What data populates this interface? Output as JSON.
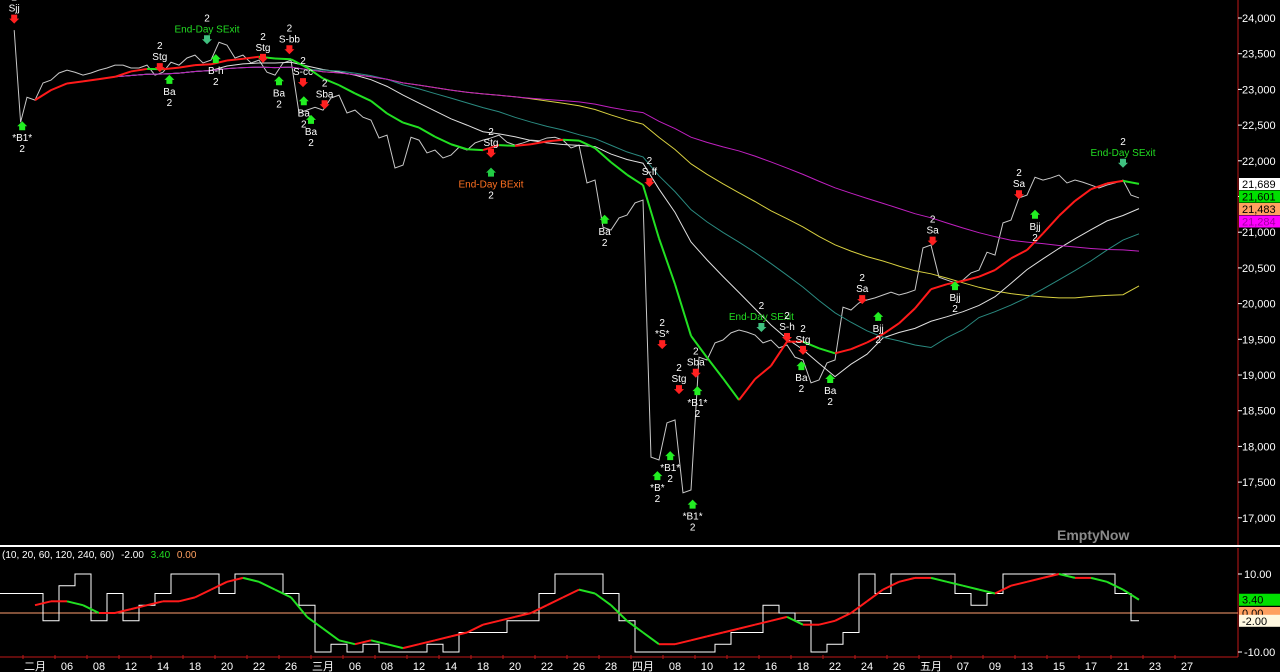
{
  "chart_data": {
    "type": "line",
    "title": "",
    "price_axis": {
      "ylim": [
        16600,
        24250
      ],
      "ticks": [
        "24,000",
        "23,500",
        "23,000",
        "22,500",
        "22,000",
        "21,500",
        "21,000",
        "20,500",
        "20,000",
        "19,500",
        "19,000",
        "18,500",
        "18,000",
        "17,500",
        "17,000"
      ],
      "tick_values": [
        24000,
        23500,
        23000,
        22500,
        22000,
        21500,
        21000,
        20500,
        20000,
        19500,
        19000,
        18500,
        18000,
        17500,
        17000
      ]
    },
    "x_axis_labels": [
      "二月",
      "06",
      "08",
      "12",
      "14",
      "18",
      "20",
      "22",
      "26",
      "三月",
      "06",
      "08",
      "12",
      "14",
      "18",
      "20",
      "22",
      "26",
      "28",
      "四月",
      "08",
      "10",
      "12",
      "16",
      "18",
      "22",
      "24",
      "26",
      "五月",
      "07",
      "09",
      "13",
      "15",
      "17",
      "21",
      "23",
      "27"
    ],
    "price": {
      "name": "Close",
      "color": "#c8c8c8",
      "start": [
        23830,
        22540
      ],
      "values": [
        22850,
        23130,
        23270,
        23200,
        23270,
        23340,
        23300,
        23340,
        23240,
        23340,
        23480,
        23410,
        23620,
        23480,
        23410,
        23200,
        23410,
        22710,
        22710,
        22920,
        22710,
        22570,
        22360,
        21940,
        22290,
        22150,
        22080,
        22150,
        22290,
        22360,
        22220,
        22290,
        22320,
        22290,
        22220,
        21730,
        21030,
        21240,
        21450,
        17810,
        18370,
        17390,
        19210,
        19490,
        19630,
        19560,
        19490,
        19420,
        19210,
        18930,
        19210,
        19910,
        20050,
        20120,
        20120,
        20190,
        20820,
        20330,
        20330,
        20470,
        20680,
        21170,
        21520,
        21730,
        21800,
        21730,
        21660,
        21660,
        21730,
        21480
      ]
    },
    "moving_averages": [
      {
        "name": "MA-yellow",
        "period": 30,
        "color": "#d8d040"
      },
      {
        "name": "MA-white",
        "period": 12,
        "color": "#e0e0e0"
      },
      {
        "name": "MA-teal",
        "period": 18,
        "color": "#2a8a80"
      },
      {
        "name": "MA-magenta",
        "period": 45,
        "color": "#c020c0"
      },
      {
        "name": "MA-trend",
        "period": 6,
        "color_up": "#ff1a1a",
        "color_down": "#22e022"
      }
    ],
    "annotations": [
      {
        "day": -1.3,
        "price": 23950,
        "label": "Sjj",
        "count": "2",
        "type": "sell"
      },
      {
        "day": -0.8,
        "price": 22540,
        "label": "*B1*",
        "count": "2",
        "type": "buy"
      },
      {
        "day": 7.8,
        "price": 23270,
        "label": "Stg",
        "count": "2",
        "type": "sell"
      },
      {
        "day": 8.4,
        "price": 23190,
        "label": "Ba",
        "count": "2",
        "type": "buy"
      },
      {
        "day": 10.75,
        "price": 23660,
        "label": "End-Day SExit",
        "count": "2",
        "type": "exit-sell"
      },
      {
        "day": 11.3,
        "price": 23480,
        "label": "B-h",
        "count": "2",
        "type": "buy"
      },
      {
        "day": 14.25,
        "price": 23400,
        "label": "Stg",
        "count": "2",
        "type": "sell"
      },
      {
        "day": 15.25,
        "price": 23170,
        "label": "Ba",
        "count": "2",
        "type": "buy"
      },
      {
        "day": 15.9,
        "price": 23520,
        "label": "S-bb",
        "count": "2",
        "type": "sell"
      },
      {
        "day": 16.75,
        "price": 23060,
        "label": "S-cc",
        "count": "2",
        "type": "sell"
      },
      {
        "day": 16.8,
        "price": 22890,
        "label": "Ba",
        "count": "2",
        "type": "buy"
      },
      {
        "day": 18.1,
        "price": 22750,
        "label": "Sba",
        "count": "2",
        "type": "sell"
      },
      {
        "day": 17.25,
        "price": 22630,
        "label": "Ba",
        "count": "2",
        "type": "buy"
      },
      {
        "day": 28.5,
        "price": 22070,
        "label": "Stg",
        "count": "2",
        "type": "sell"
      },
      {
        "day": 28.5,
        "price": 21890,
        "label": "End-Day BExit",
        "count": "2",
        "type": "exit-buy"
      },
      {
        "day": 35.6,
        "price": 21230,
        "label": "Ba",
        "count": "2",
        "type": "buy"
      },
      {
        "day": 38.4,
        "price": 21660,
        "label": "S-ff",
        "count": "2",
        "type": "sell"
      },
      {
        "day": 39.2,
        "price": 19390,
        "label": "*S*",
        "count": "2",
        "type": "sell"
      },
      {
        "day": 38.9,
        "price": 17640,
        "label": "*B*",
        "count": "2",
        "type": "buy"
      },
      {
        "day": 39.7,
        "price": 17920,
        "label": "*B1*",
        "count": "2",
        "type": "buy"
      },
      {
        "day": 40.25,
        "price": 18760,
        "label": "Stg",
        "count": "2",
        "type": "sell"
      },
      {
        "day": 41.3,
        "price": 18990,
        "label": "Sba",
        "count": "2",
        "type": "sell"
      },
      {
        "day": 41.4,
        "price": 18830,
        "label": "*B1*",
        "count": "2",
        "type": "buy"
      },
      {
        "day": 41.1,
        "price": 17240,
        "label": "*B1*",
        "count": "2",
        "type": "buy"
      },
      {
        "day": 45.4,
        "price": 19630,
        "label": "End-Day SExit",
        "count": "2",
        "type": "exit-sell"
      },
      {
        "day": 47,
        "price": 19490,
        "label": "S-h",
        "count": "2",
        "type": "sell"
      },
      {
        "day": 48,
        "price": 19310,
        "label": "Stg",
        "count": "2",
        "type": "sell"
      },
      {
        "day": 47.9,
        "price": 19180,
        "label": "Ba",
        "count": "2",
        "type": "buy"
      },
      {
        "day": 49.7,
        "price": 19000,
        "label": "Ba",
        "count": "2",
        "type": "buy"
      },
      {
        "day": 51.7,
        "price": 20020,
        "label": "Sa",
        "count": "2",
        "type": "sell"
      },
      {
        "day": 52.7,
        "price": 19870,
        "label": "Bjj",
        "count": "2",
        "type": "buy"
      },
      {
        "day": 56.1,
        "price": 20840,
        "label": "Sa",
        "count": "2",
        "type": "sell"
      },
      {
        "day": 57.5,
        "price": 20300,
        "label": "Bjj",
        "count": "2",
        "type": "buy"
      },
      {
        "day": 61.5,
        "price": 21490,
        "label": "Sa",
        "count": "2",
        "type": "sell"
      },
      {
        "day": 62.5,
        "price": 21300,
        "label": "Bjj",
        "count": "2",
        "type": "buy"
      },
      {
        "day": 68,
        "price": 21930,
        "label": "End-Day SExit",
        "count": "2",
        "type": "exit-sell"
      }
    ],
    "price_tags": [
      {
        "value": "21,689",
        "bg": "#ffffff",
        "fg": "#000000",
        "price": 21689
      },
      {
        "value": "21,601",
        "bg": "#00e000",
        "fg": "#000000",
        "price": 21601
      },
      {
        "value": "21,483",
        "bg": "#ffa060",
        "fg": "#000000",
        "price": 21483
      },
      {
        "value": "21,284",
        "bg": "#ff00ff",
        "fg": "#a000a0",
        "price": 21284
      }
    ],
    "oscillator": {
      "params": "(10, 20, 60, 120, 240, 60)",
      "readings": [
        {
          "value": "-2.00",
          "color": "#ffffff"
        },
        {
          "value": "3.40",
          "color": "#22dd22"
        },
        {
          "value": "0.00",
          "color": "#ffa060"
        }
      ],
      "ylim": [
        -10,
        10
      ],
      "ticks": [
        "10.00",
        "-10.00"
      ],
      "tick_values": [
        10,
        -10
      ],
      "zero_line": 0,
      "tags": [
        {
          "value": "3.40",
          "bg": "#00e000",
          "fg": "#000000",
          "level": 3.4
        },
        {
          "value": "0.00",
          "bg": "#ffa060",
          "fg": "#000000",
          "level": 0
        },
        {
          "value": "-2.00",
          "bg": "#fff8e0",
          "fg": "#000000",
          "level": -2
        }
      ],
      "smooth": [
        2,
        3,
        3,
        2,
        0,
        0,
        1,
        2,
        3,
        3,
        4,
        6,
        8,
        9,
        8,
        6,
        4,
        -1,
        -4,
        -7,
        -8,
        -7,
        -8,
        -9,
        -8,
        -7,
        -6,
        -5,
        -3,
        -2,
        -1,
        0,
        2,
        4,
        6,
        5,
        2,
        -2,
        -5,
        -8,
        -8,
        -7,
        -6,
        -5,
        -4,
        -3,
        -2,
        -1,
        -3,
        -3,
        -2,
        0,
        3,
        6,
        8,
        9,
        9,
        8,
        7,
        6,
        5,
        7,
        8,
        9,
        10,
        9,
        9,
        8,
        6,
        3.4
      ],
      "step": [
        5,
        -2,
        7,
        10,
        -2,
        5,
        -2,
        2,
        5,
        10,
        10,
        10,
        5,
        10,
        10,
        10,
        5,
        2,
        -10,
        -8,
        -10,
        -8,
        -10,
        -10,
        -10,
        -8,
        -10,
        -5,
        -5,
        -5,
        -2,
        -2,
        5,
        10,
        10,
        10,
        5,
        -2,
        -10,
        -10,
        -10,
        -10,
        -10,
        -8,
        -5,
        -5,
        2,
        0,
        -2,
        -10,
        -8,
        -5,
        10,
        5,
        10,
        10,
        10,
        10,
        5,
        2,
        5,
        10,
        10,
        10,
        10,
        10,
        10,
        10,
        5,
        -2
      ]
    }
  },
  "watermark": "EmptyNow"
}
